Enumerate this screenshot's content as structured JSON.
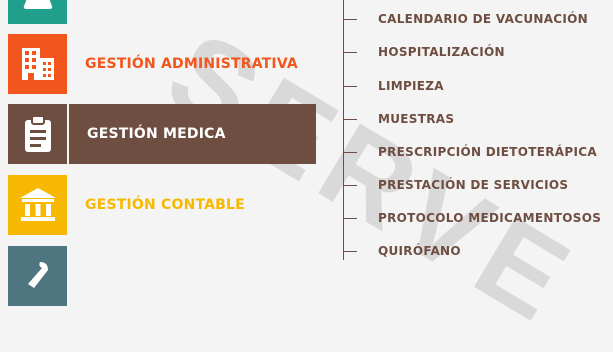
{
  "watermark": "SERVE",
  "menu": [
    {
      "id": "top-partial",
      "label": "",
      "icon": "flask-icon",
      "tile_color": "#1f9f8c",
      "label_color": "#1f9f8c"
    },
    {
      "id": "administrativa",
      "label": "GESTIÓN ADMINISTRATIVA",
      "icon": "building-icon",
      "tile_color": "#f2561d",
      "label_color": "#f2561d"
    },
    {
      "id": "medica",
      "label": "GESTIÓN MEDICA",
      "icon": "clipboard-icon",
      "tile_color": "#6e4e41",
      "label_color": "#ffffff"
    },
    {
      "id": "contable",
      "label": "GESTIÓN CONTABLE",
      "icon": "bank-icon",
      "tile_color": "#f6b800",
      "label_color": "#f6b800"
    },
    {
      "id": "bottom-partial",
      "label": "",
      "icon": "wrench-icon",
      "tile_color": "#4f7580",
      "label_color": "#4f7580"
    }
  ],
  "submenu": [
    "CALENDARIO DE VACUNACIÓN",
    "HOSPITALIZACIÓN",
    "LIMPIEZA",
    "MUESTRAS",
    "PRESCRIPCIÓN DIETOTERÁPICA",
    "PRESTACIÓN DE SERVICIOS",
    "PROTOCOLO MEDICAMENTOSOS",
    "QUIRÓFANO"
  ]
}
